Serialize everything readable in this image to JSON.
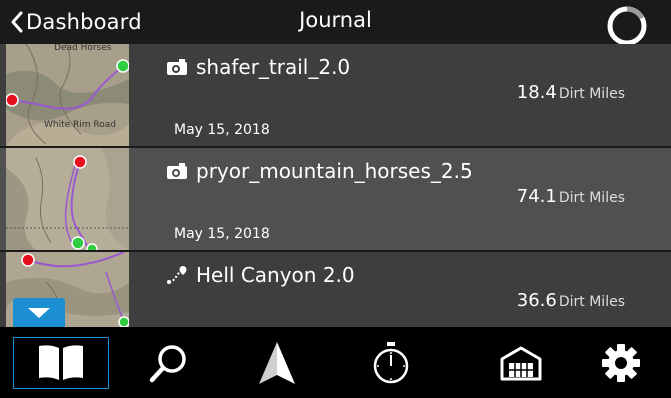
{
  "header": {
    "back_label": "Dashboard",
    "title": "Journal",
    "sync_icon": "sync-ring-icon"
  },
  "entries": [
    {
      "title": "shafer_trail_2.0",
      "icon": "camera-icon",
      "miles": "18.4",
      "unit": "Dirt Miles",
      "date": "May 15, 2018",
      "map_labels": [
        "Dead Horses",
        "White Rim Road"
      ]
    },
    {
      "title": "pryor_mountain_horses_2.5",
      "icon": "camera-icon",
      "miles": "74.1",
      "unit": "Dirt Miles",
      "date": "May 15, 2018",
      "map_labels": []
    },
    {
      "title": "Hell Canyon 2.0",
      "icon": "route-icon",
      "miles": "36.6",
      "unit": "Dirt Miles",
      "date": "",
      "map_labels": []
    }
  ],
  "tabs": [
    {
      "name": "journal",
      "icon": "book-icon",
      "active": true
    },
    {
      "name": "search",
      "icon": "search-icon",
      "active": false
    },
    {
      "name": "navigate",
      "icon": "navigation-arrow-icon",
      "active": false
    },
    {
      "name": "timer",
      "icon": "stopwatch-icon",
      "active": false
    },
    {
      "name": "garage",
      "icon": "garage-icon",
      "active": false
    },
    {
      "name": "settings",
      "icon": "gear-icon",
      "active": false
    }
  ],
  "colors": {
    "accent": "#1b8fd2",
    "start_marker": "#2ecc40",
    "end_marker": "#e8101c",
    "row_dark": "#3e3e3e",
    "row_light": "#505050"
  }
}
